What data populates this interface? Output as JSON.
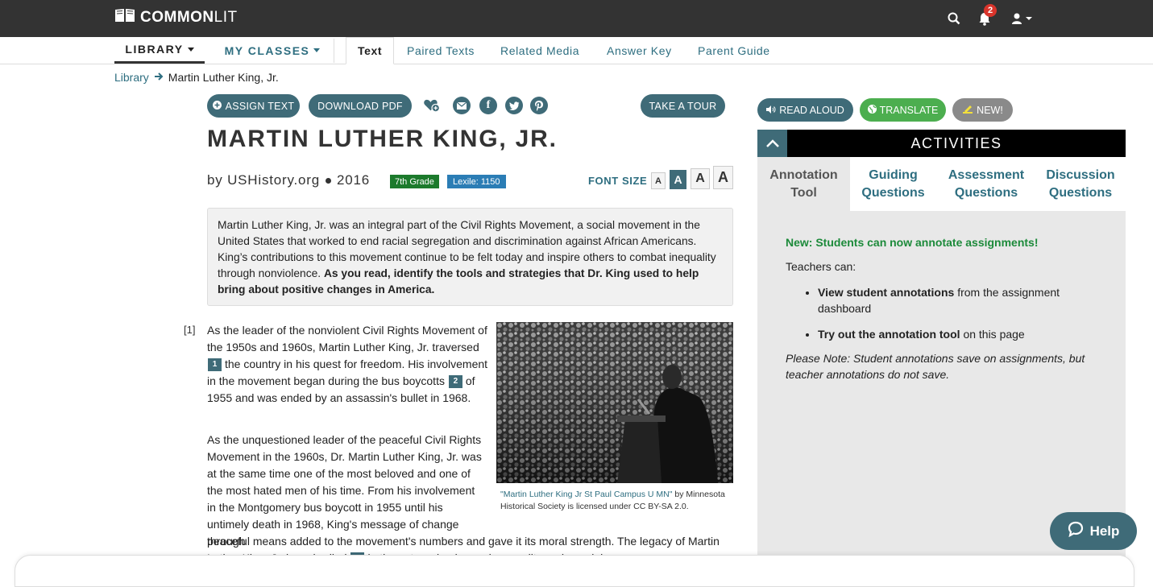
{
  "brand": {
    "prefix": "COMMON",
    "suffix": "LIT"
  },
  "topbar": {
    "notification_count": "2"
  },
  "nav": {
    "library": "LIBRARY",
    "my_classes": "MY CLASSES"
  },
  "tabs": [
    "Text",
    "Paired Texts",
    "Related Media",
    "Answer Key",
    "Parent Guide"
  ],
  "breadcrumb": {
    "root": "Library",
    "current": "Martin Luther King, Jr."
  },
  "actions": {
    "assign": "ASSIGN TEXT",
    "download": "DOWNLOAD PDF",
    "tour": "TAKE A TOUR"
  },
  "text": {
    "title": "MARTIN LUTHER KING, JR.",
    "author": "by USHistory.org",
    "year": "2016",
    "grade": "7th Grade",
    "lexile": "Lexile: 1150",
    "font_size_label": "FONT SIZE",
    "font_sizes": [
      "A",
      "A",
      "A",
      "A"
    ],
    "intro_plain": "Martin Luther King, Jr. was an integral part of the Civil Rights Movement, a social movement in the United States that worked to end racial segregation and discrimination against African Americans. King’s contributions to this movement continue to be felt today and inspire others to combat inequality through nonviolence.",
    "intro_bold": "As you read, identify the tools and strategies that Dr. King used to help bring about positive changes in America.",
    "para_number": "[1]",
    "p1_a": "As the leader of the nonviolent Civil Rights Movement of the 1950s and 1960s, Martin Luther King, Jr. traversed",
    "p1_fn1": "1",
    "p1_b": "the country in his quest for freedom. His involvement in the movement began during the bus boycotts",
    "p1_fn2": "2",
    "p1_c": "of 1955 and was ended by an assassin's bullet in 1968.",
    "p2_a": "As the unquestioned leader of the peaceful Civil Rights Movement in the 1960s, Dr. Martin Luther King, Jr. was at the same time one of the most beloved and one of the most hated men of his time. From his involvement in the Montgomery bus boycott in 1955 until his untimely death in 1968, King's message of change through",
    "p2_b": "peaceful means added to the movement's numbers and gave it its moral strength. The legacy of Martin Luther King, Jr. is embodied",
    "p2_fn3": "3",
    "p2_c": "in these two simple words: equality and nonviolence.",
    "caption_link": "\"Martin Luther King Jr St Paul Campus U MN\"",
    "caption_rest": "by Minnesota Historical Society is licensed under CC BY-SA 2.0."
  },
  "right": {
    "read_aloud": "READ ALOUD",
    "translate": "TRANSLATE",
    "new": "NEW!",
    "panel_title": "ACTIVITIES",
    "tabs": [
      "Annotation Tool",
      "Guiding Questions",
      "Assessment Questions",
      "Discussion Questions"
    ],
    "headline": "New: Students can now annotate assignments!",
    "teachers_can": "Teachers can:",
    "bullet1_bold": "View student annotations",
    "bullet1_rest": "from the assignment dashboard",
    "bullet2_bold": "Try out the annotation tool",
    "bullet2_rest": "on this page",
    "note": "Please Note: Student annotations save on assignments, but teacher annotations do not save."
  },
  "help": {
    "label": "Help"
  },
  "colors": {
    "accent": "#3f6b78",
    "topbar": "#333333",
    "grade": "#1c7a2c",
    "lexile": "#2b7db5",
    "translate": "#4cae4f",
    "new": "#8a8a8a"
  }
}
